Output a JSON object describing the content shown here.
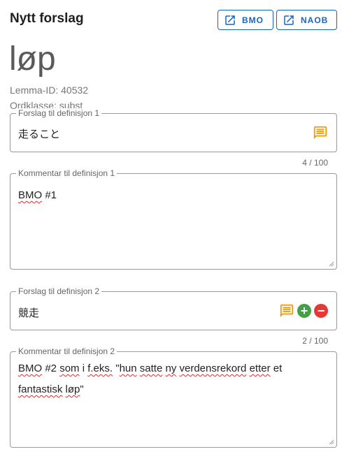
{
  "header": {
    "title": "Nytt forslag",
    "bmo_label": "BMO",
    "naob_label": "NAOB"
  },
  "lemma": {
    "word": "løp",
    "id_text": "Lemma-ID: 40532",
    "class_text": "Ordklasse: subst"
  },
  "definitions": [
    {
      "label": "Forslag til definisjon 1",
      "value": "走ること",
      "counter": "4 / 100",
      "comment_label": "Kommentar til definisjon 1",
      "comment_words": [
        "BMO",
        " #1"
      ]
    },
    {
      "label": "Forslag til definisjon 2",
      "value": "競走",
      "counter": "2 / 100",
      "comment_label": "Kommentar til definisjon 2",
      "comment_words": [
        "BMO",
        " #2 ",
        "som",
        " i ",
        "f.eks.",
        " \"",
        "hun",
        " ",
        "satte",
        " ",
        "ny",
        " ",
        "verdensrekord",
        " ",
        "etter",
        " et ",
        "fantastisk",
        " ",
        "løp",
        "\""
      ]
    }
  ],
  "colors": {
    "accent": "#1565c0",
    "comment_icon": "#f29b0c",
    "add": "#43a047",
    "remove": "#e53935"
  },
  "icons": {
    "external": "open-in-new-icon",
    "comment": "comment-icon",
    "add": "add-circle-icon",
    "remove": "remove-circle-icon"
  }
}
